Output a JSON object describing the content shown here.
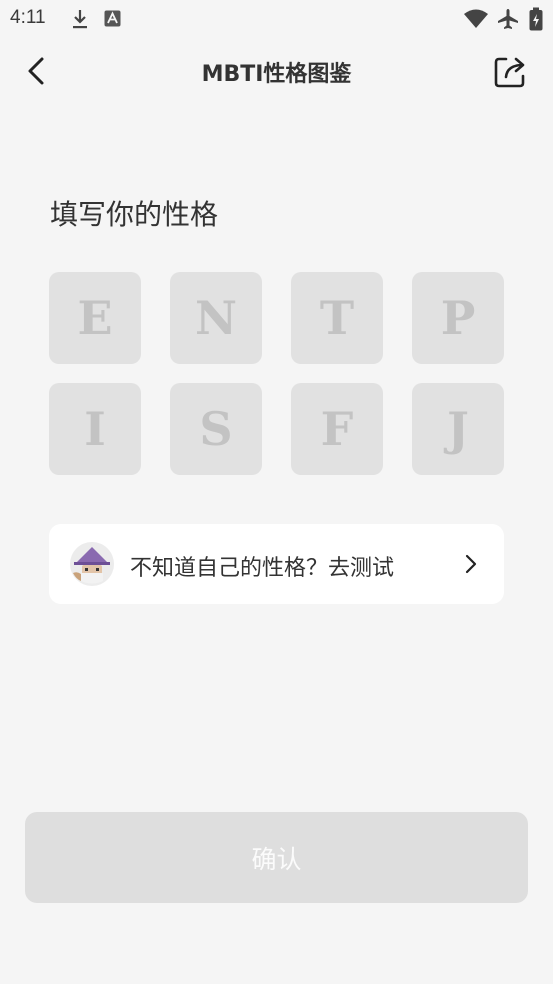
{
  "status_bar": {
    "time": "4:11",
    "icons": [
      "download-icon",
      "a-badge-icon",
      "wifi-icon",
      "airplane-icon",
      "battery-icon"
    ]
  },
  "header": {
    "title": "MBTI性格图鉴",
    "back_icon": "chevron-left-icon",
    "share_icon": "share-icon"
  },
  "section": {
    "title": "填写你的性格"
  },
  "letters": {
    "row1": [
      "E",
      "N",
      "T",
      "P"
    ],
    "row2": [
      "I",
      "S",
      "F",
      "J"
    ]
  },
  "test_card": {
    "text": "不知道自己的性格？去测试",
    "avatar_icon": "wizard-avatar-icon",
    "arrow_icon": "chevron-right-icon"
  },
  "confirm": {
    "label": "确认"
  },
  "colors": {
    "background": "#f5f5f5",
    "tile": "#e1e1e1",
    "tile_text": "#c3c3c3",
    "card": "#ffffff",
    "button_disabled": "#dedede",
    "text": "#333333"
  }
}
